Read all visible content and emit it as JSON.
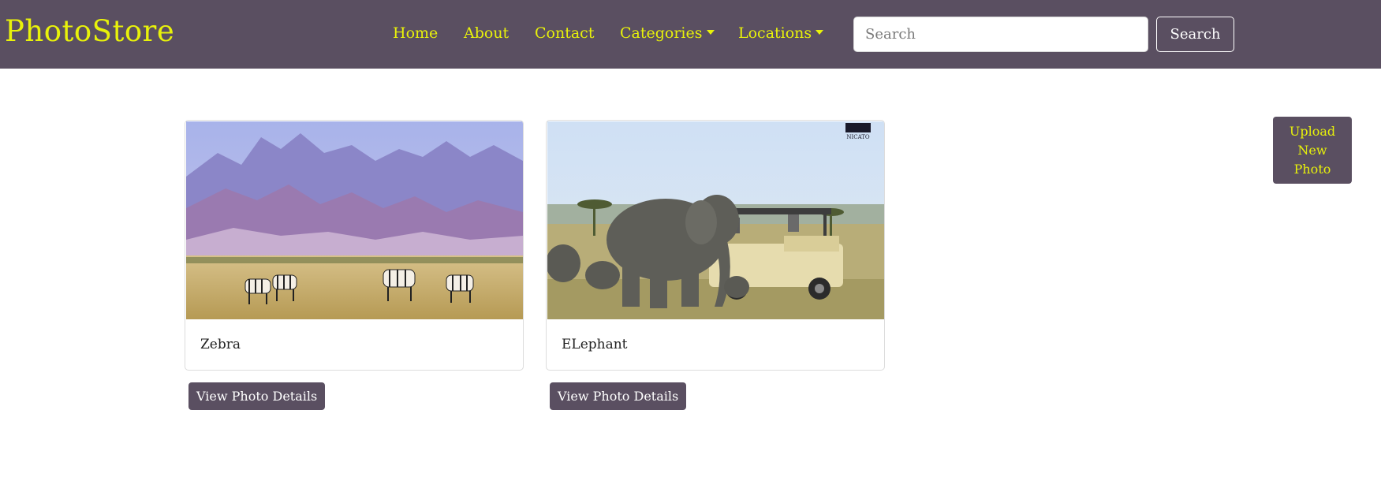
{
  "navbar": {
    "brand": "PhotoStore",
    "links": [
      "Home",
      "About",
      "Contact"
    ],
    "dropdowns": [
      "Categories",
      "Locations"
    ],
    "search": {
      "placeholder": "Search",
      "value": "",
      "button_label": "Search"
    },
    "colors": {
      "background": "#5a4f61",
      "link": "#e8f20a"
    }
  },
  "photos": [
    {
      "title": "Zebra",
      "image": "zebra-savanna-photo",
      "button_label": "View Photo Details"
    },
    {
      "title": "ELephant",
      "image": "elephant-safari-photo",
      "watermark": "NICATO",
      "button_label": "View Photo Details"
    }
  ],
  "upload_button": {
    "label": "Upload New Photo"
  }
}
